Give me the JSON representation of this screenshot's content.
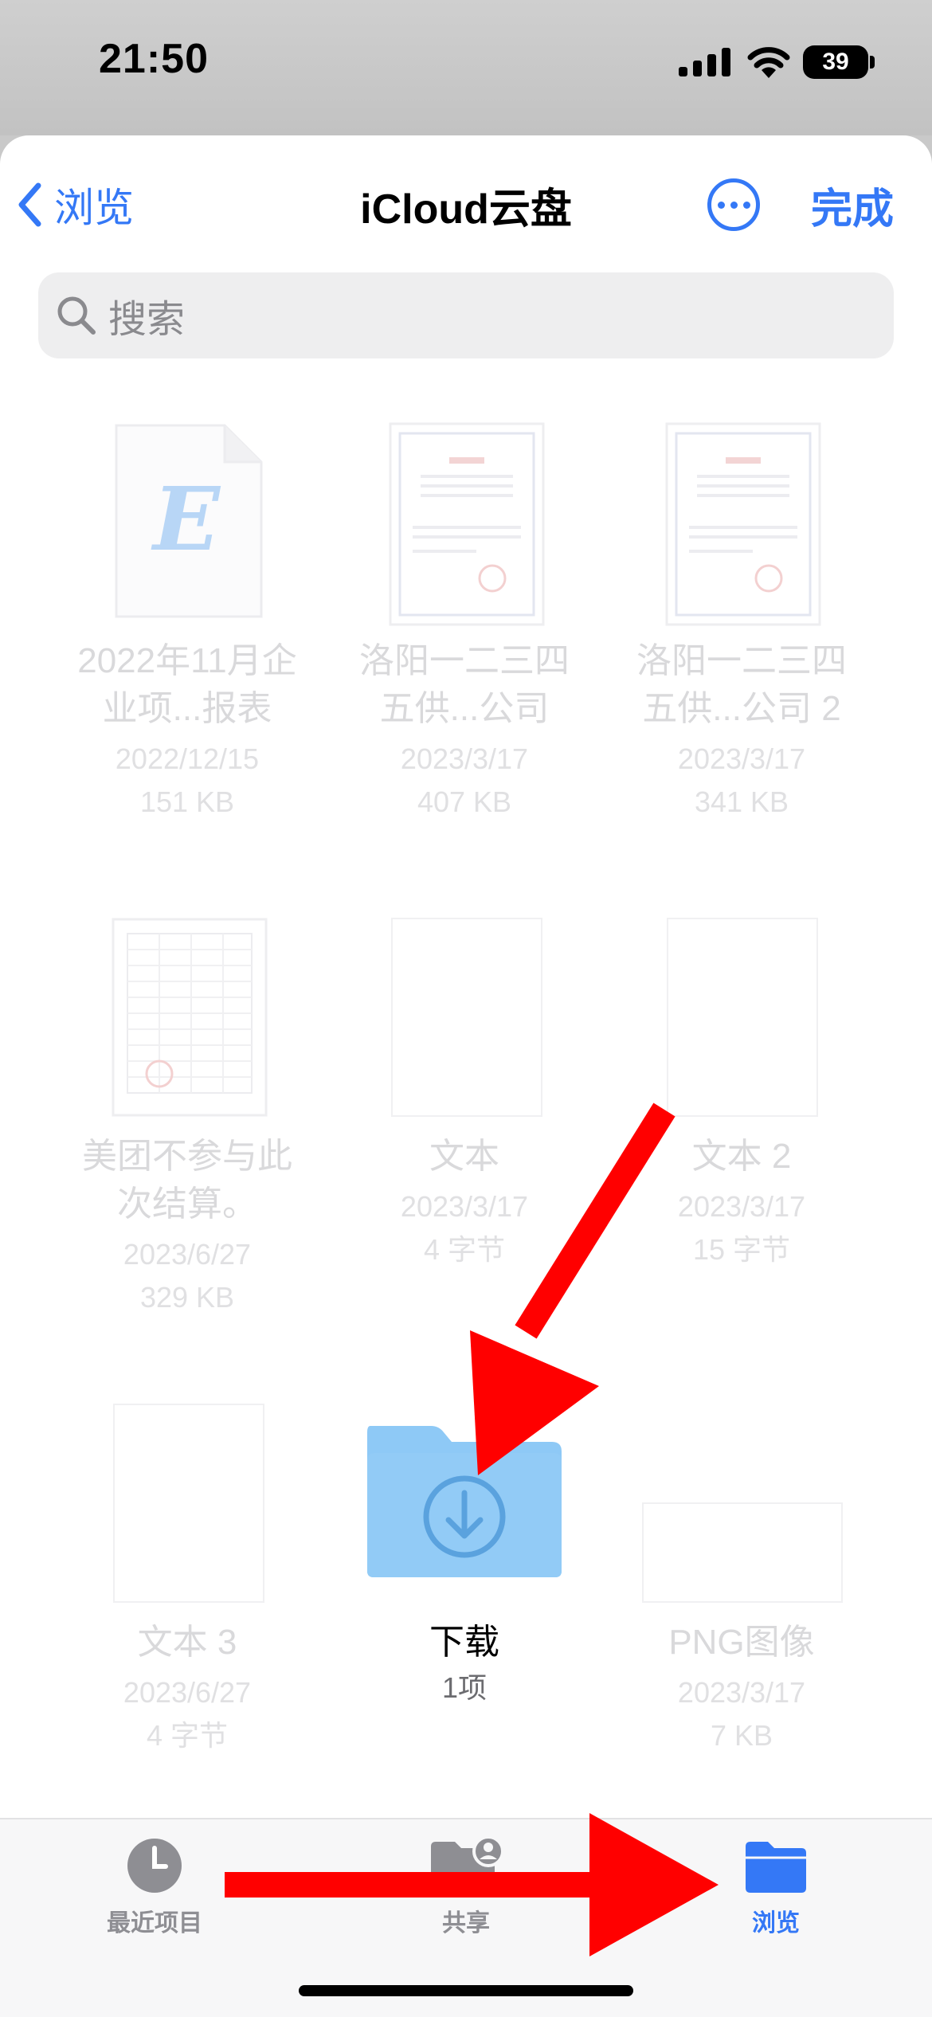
{
  "status_bar": {
    "time": "21:50",
    "battery": "39"
  },
  "nav": {
    "back_label": "浏览",
    "title": "iCloud云盘",
    "done_label": "完成"
  },
  "search": {
    "placeholder": "搜索"
  },
  "files": [
    {
      "name_line1": "2022年11月企",
      "name_line2": "业项...报表",
      "date": "2022/12/15",
      "size": "151 KB",
      "icon": "excel-file-icon"
    },
    {
      "name_line1": "洛阳一二三四",
      "name_line2": "五供...公司",
      "date": "2023/3/17",
      "size": "407 KB",
      "icon": "certificate-thumbnail"
    },
    {
      "name_line1": "洛阳一二三四",
      "name_line2": "五供...公司 2",
      "date": "2023/3/17",
      "size": "341 KB",
      "icon": "certificate-thumbnail"
    },
    {
      "name_line1": "美团不参与此",
      "name_line2": "次结算。",
      "date": "2023/6/27",
      "size": "329 KB",
      "icon": "spreadsheet-thumbnail"
    },
    {
      "name_line1": "文本",
      "date": "2023/3/17",
      "size": "4 字节",
      "icon": "text-file-icon"
    },
    {
      "name_line1": "文本 2",
      "date": "2023/3/17",
      "size": "15 字节",
      "icon": "text-file-icon"
    },
    {
      "name_line1": "文本 3",
      "date": "2023/6/27",
      "size": "4 字节",
      "icon": "text-file-icon"
    },
    {
      "name_line1": "下载",
      "size": "1项",
      "icon": "download-folder-icon"
    },
    {
      "name_line1": "PNG图像",
      "date": "2023/3/17",
      "size": "7 KB",
      "icon": "image-file-icon"
    }
  ],
  "tabs": [
    {
      "label": "最近项目",
      "icon": "clock-icon"
    },
    {
      "label": "共享",
      "icon": "shared-folder-icon"
    },
    {
      "label": "浏览",
      "icon": "folder-icon",
      "selected": true
    }
  ],
  "colors": {
    "accent": "#3478f6",
    "annotation_arrow": "#ff0000",
    "folder": "#8ec9f6"
  }
}
